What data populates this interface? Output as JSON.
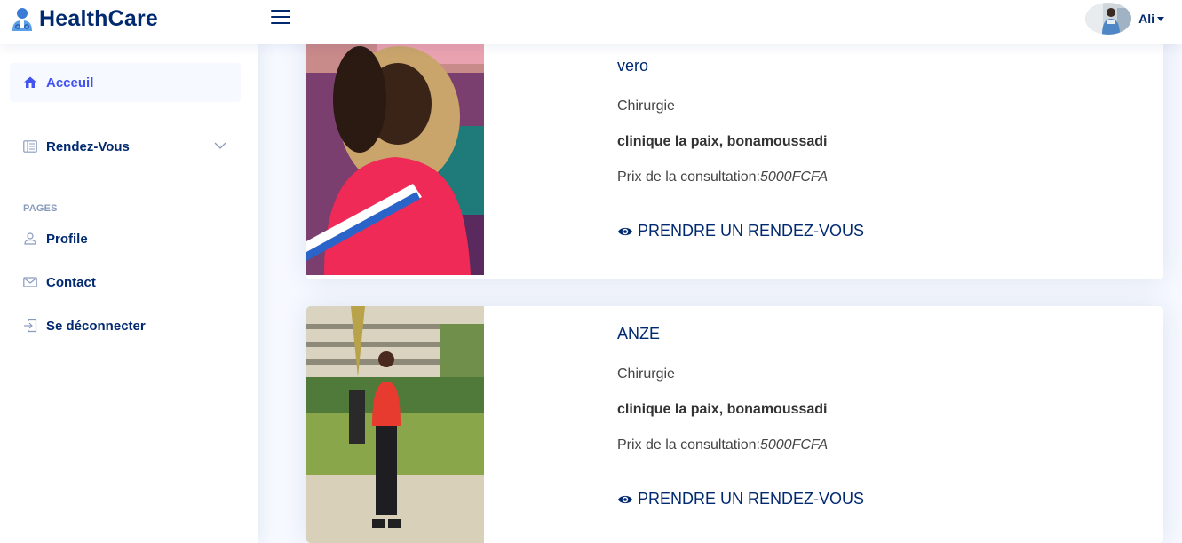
{
  "app": {
    "name": "HealthCare",
    "icons": {
      "logo": "doctor-logo-icon",
      "menu": "hamburger-menu-icon"
    }
  },
  "header": {
    "user_name": "Ali"
  },
  "sidebar": {
    "items": [
      {
        "label": "Acceuil",
        "icon": "house-icon",
        "active": true
      },
      {
        "label": "Rendez-Vous",
        "icon": "layout-text-icon",
        "expandable": true
      }
    ],
    "pages_heading": "PAGES",
    "pages": [
      {
        "label": "Profile",
        "icon": "person-icon"
      },
      {
        "label": "Contact",
        "icon": "envelope-icon"
      },
      {
        "label": "Se déconnecter",
        "icon": "box-arrow-in-right-icon"
      }
    ]
  },
  "doctors": [
    {
      "name": "vero",
      "specialty": "Chirurgie",
      "clinic": "clinique la paix, bonamoussadi",
      "price_label": "Prix de la consultation:",
      "price_value": "5000FCFA",
      "action": "PRENDRE UN RENDEZ-VOUS"
    },
    {
      "name": "ANZE",
      "specialty": "Chirurgie",
      "clinic": "clinique la paix, bonamoussadi",
      "price_label": "Prix de la consultation:",
      "price_value": "5000FCFA",
      "action": "PRENDRE UN RENDEZ-VOUS"
    }
  ],
  "colors": {
    "primary": "#012970",
    "accent": "#4154f1",
    "background": "#f6f9ff"
  }
}
